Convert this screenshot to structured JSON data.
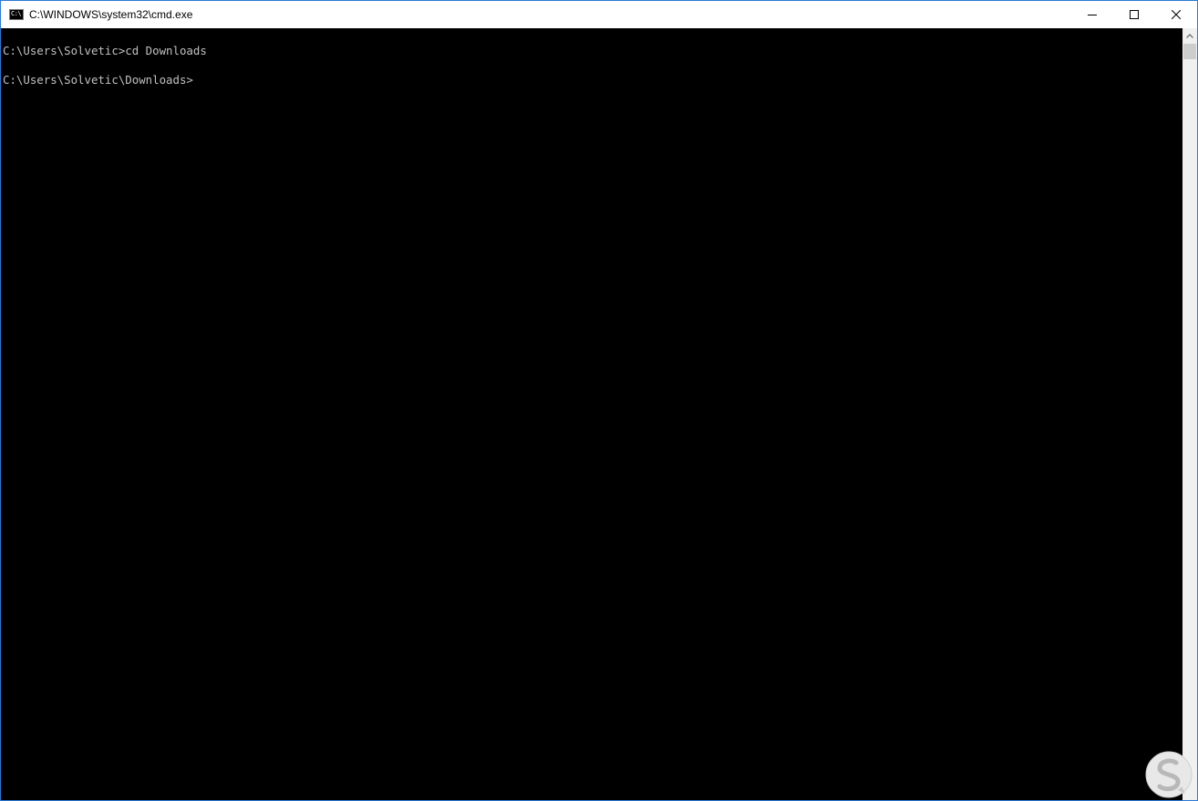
{
  "window": {
    "title": "C:\\WINDOWS\\system32\\cmd.exe",
    "app_icon_label": "C:\\",
    "border_color": "#2b79d6"
  },
  "caption_buttons": {
    "minimize_icon": "minimize-icon",
    "maximize_icon": "maximize-icon",
    "close_icon": "close-icon"
  },
  "console": {
    "background": "#000000",
    "foreground": "#c0c0c0",
    "lines": [
      "C:\\Users\\Solvetic>cd Downloads",
      "C:\\Users\\Solvetic\\Downloads>"
    ]
  },
  "scrollbar": {
    "up_arrow_icon": "chevron-up-icon"
  },
  "watermark": {
    "logo_icon": "solvetic-logo-icon"
  }
}
